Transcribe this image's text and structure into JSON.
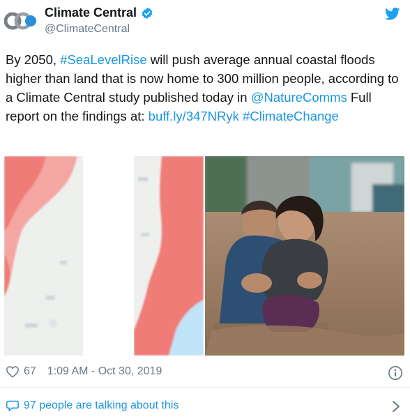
{
  "author": {
    "display_name": "Climate Central",
    "handle": "@ClimateCentral",
    "logo_icon": "climate-central-logo",
    "verified_icon": "verified-badge-icon"
  },
  "tweet_text": {
    "part1": "By 2050, ",
    "hashtag1": "#SeaLevelRise",
    "part2": " will push average annual coastal floods higher than land that is now home to 300 million people, according to a Climate Central study published today in ",
    "mention": "@NatureComms",
    "part3": " Full report on the findings at: ",
    "url": "buff.ly/347NRyk",
    "part4": " ",
    "hashtag2": "#ClimateChange"
  },
  "stats": {
    "likes": "67",
    "timestamp": "1:09 AM - Oct 30, 2019"
  },
  "conversation": {
    "label": "97 people are talking about this"
  },
  "colors": {
    "link": "#1b95e0",
    "secondary": "#657786",
    "flood_red": "#f07b78"
  }
}
